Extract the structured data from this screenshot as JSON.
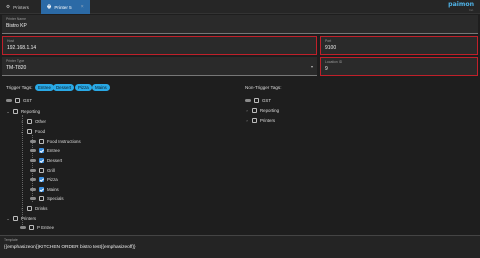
{
  "tabs": [
    {
      "label": "Printers",
      "icon": "gear-icon"
    },
    {
      "label": "Printer 5",
      "icon": "printer-icon",
      "close": "×"
    }
  ],
  "logo": {
    "name": "paimon",
    "sub": "Inc."
  },
  "form": {
    "printer_name": {
      "label": "Printer Name",
      "value": "Bistro KP"
    },
    "host": {
      "label": "Host",
      "value": "192.168.1.14"
    },
    "port": {
      "label": "Port",
      "value": "9100"
    },
    "printer_type": {
      "label": "Printer Type",
      "value": "TM-T820"
    },
    "location_id": {
      "label": "Location ID",
      "value": "9"
    }
  },
  "trigger": {
    "title": "Trigger Tags:",
    "chips": [
      "Entree",
      "Dessert",
      "Pizza",
      "Mains"
    ],
    "tree": [
      "GST",
      "Reporting",
      "Other",
      "Food",
      "Food Instructions",
      "Entree",
      "Dessert",
      "Grill",
      "Pizza",
      "Mains",
      "Specials",
      "Drinks",
      "Printers",
      "P Entree"
    ]
  },
  "non_trigger": {
    "title": "Non-Trigger Tags:",
    "tree": [
      "GST",
      "Reporting",
      "Printers"
    ]
  },
  "template": {
    "label": "Template",
    "value": "{{emphasizeon}}KITCHEN ORDER bistro test{{emphasizeoff}}"
  },
  "colors": {
    "accent": "#2b6aa6",
    "chip": "#29a9e6",
    "error": "#c0202a",
    "checkbox": "#3a8fe0"
  }
}
